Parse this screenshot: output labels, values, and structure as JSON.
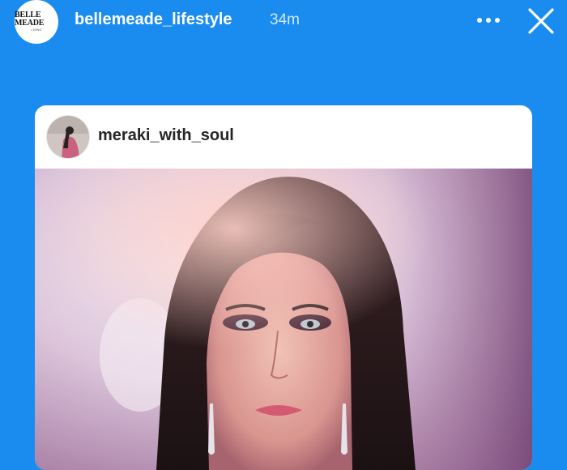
{
  "story": {
    "avatar_logo": {
      "main": "BELLE MEADE",
      "sub": "LIVING"
    },
    "username": "bellemeade_lifestyle",
    "timestamp": "34m",
    "background_color": "#1a8cf0",
    "icons": {
      "more": "more-horizontal-icon",
      "close": "close-icon"
    }
  },
  "shared_post": {
    "username": "meraki_with_soul",
    "image": "portrait-photo"
  }
}
